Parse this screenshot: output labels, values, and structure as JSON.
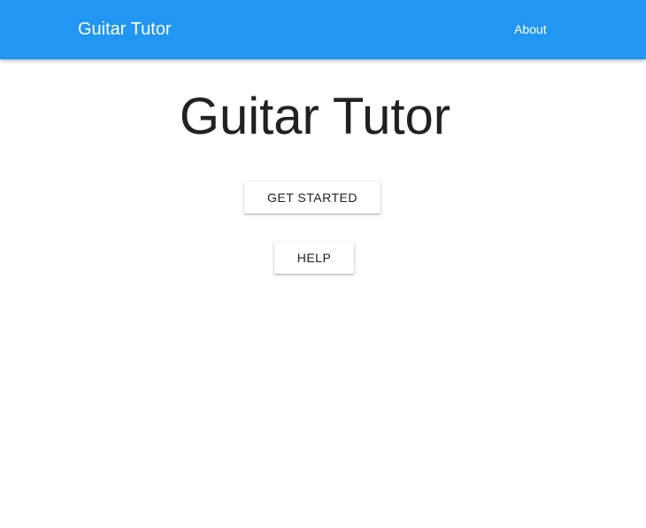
{
  "app_bar": {
    "title": "Guitar Tutor",
    "nav": {
      "about_label": "About"
    },
    "color": "#2196f3"
  },
  "main": {
    "heading": "Guitar Tutor",
    "buttons": {
      "get_started_label": "GET STARTED",
      "help_label": "HELP"
    }
  }
}
